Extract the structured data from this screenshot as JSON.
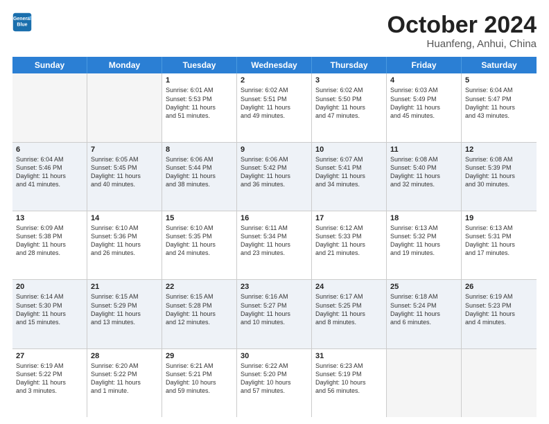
{
  "header": {
    "logo_line1": "General",
    "logo_line2": "Blue",
    "title": "October 2024",
    "subtitle": "Huanfeng, Anhui, China"
  },
  "weekdays": [
    "Sunday",
    "Monday",
    "Tuesday",
    "Wednesday",
    "Thursday",
    "Friday",
    "Saturday"
  ],
  "rows": [
    [
      {
        "day": "",
        "info": ""
      },
      {
        "day": "",
        "info": ""
      },
      {
        "day": "1",
        "info": "Sunrise: 6:01 AM\nSunset: 5:53 PM\nDaylight: 11 hours\nand 51 minutes."
      },
      {
        "day": "2",
        "info": "Sunrise: 6:02 AM\nSunset: 5:51 PM\nDaylight: 11 hours\nand 49 minutes."
      },
      {
        "day": "3",
        "info": "Sunrise: 6:02 AM\nSunset: 5:50 PM\nDaylight: 11 hours\nand 47 minutes."
      },
      {
        "day": "4",
        "info": "Sunrise: 6:03 AM\nSunset: 5:49 PM\nDaylight: 11 hours\nand 45 minutes."
      },
      {
        "day": "5",
        "info": "Sunrise: 6:04 AM\nSunset: 5:47 PM\nDaylight: 11 hours\nand 43 minutes."
      }
    ],
    [
      {
        "day": "6",
        "info": "Sunrise: 6:04 AM\nSunset: 5:46 PM\nDaylight: 11 hours\nand 41 minutes."
      },
      {
        "day": "7",
        "info": "Sunrise: 6:05 AM\nSunset: 5:45 PM\nDaylight: 11 hours\nand 40 minutes."
      },
      {
        "day": "8",
        "info": "Sunrise: 6:06 AM\nSunset: 5:44 PM\nDaylight: 11 hours\nand 38 minutes."
      },
      {
        "day": "9",
        "info": "Sunrise: 6:06 AM\nSunset: 5:42 PM\nDaylight: 11 hours\nand 36 minutes."
      },
      {
        "day": "10",
        "info": "Sunrise: 6:07 AM\nSunset: 5:41 PM\nDaylight: 11 hours\nand 34 minutes."
      },
      {
        "day": "11",
        "info": "Sunrise: 6:08 AM\nSunset: 5:40 PM\nDaylight: 11 hours\nand 32 minutes."
      },
      {
        "day": "12",
        "info": "Sunrise: 6:08 AM\nSunset: 5:39 PM\nDaylight: 11 hours\nand 30 minutes."
      }
    ],
    [
      {
        "day": "13",
        "info": "Sunrise: 6:09 AM\nSunset: 5:38 PM\nDaylight: 11 hours\nand 28 minutes."
      },
      {
        "day": "14",
        "info": "Sunrise: 6:10 AM\nSunset: 5:36 PM\nDaylight: 11 hours\nand 26 minutes."
      },
      {
        "day": "15",
        "info": "Sunrise: 6:10 AM\nSunset: 5:35 PM\nDaylight: 11 hours\nand 24 minutes."
      },
      {
        "day": "16",
        "info": "Sunrise: 6:11 AM\nSunset: 5:34 PM\nDaylight: 11 hours\nand 23 minutes."
      },
      {
        "day": "17",
        "info": "Sunrise: 6:12 AM\nSunset: 5:33 PM\nDaylight: 11 hours\nand 21 minutes."
      },
      {
        "day": "18",
        "info": "Sunrise: 6:13 AM\nSunset: 5:32 PM\nDaylight: 11 hours\nand 19 minutes."
      },
      {
        "day": "19",
        "info": "Sunrise: 6:13 AM\nSunset: 5:31 PM\nDaylight: 11 hours\nand 17 minutes."
      }
    ],
    [
      {
        "day": "20",
        "info": "Sunrise: 6:14 AM\nSunset: 5:30 PM\nDaylight: 11 hours\nand 15 minutes."
      },
      {
        "day": "21",
        "info": "Sunrise: 6:15 AM\nSunset: 5:29 PM\nDaylight: 11 hours\nand 13 minutes."
      },
      {
        "day": "22",
        "info": "Sunrise: 6:15 AM\nSunset: 5:28 PM\nDaylight: 11 hours\nand 12 minutes."
      },
      {
        "day": "23",
        "info": "Sunrise: 6:16 AM\nSunset: 5:27 PM\nDaylight: 11 hours\nand 10 minutes."
      },
      {
        "day": "24",
        "info": "Sunrise: 6:17 AM\nSunset: 5:25 PM\nDaylight: 11 hours\nand 8 minutes."
      },
      {
        "day": "25",
        "info": "Sunrise: 6:18 AM\nSunset: 5:24 PM\nDaylight: 11 hours\nand 6 minutes."
      },
      {
        "day": "26",
        "info": "Sunrise: 6:19 AM\nSunset: 5:23 PM\nDaylight: 11 hours\nand 4 minutes."
      }
    ],
    [
      {
        "day": "27",
        "info": "Sunrise: 6:19 AM\nSunset: 5:22 PM\nDaylight: 11 hours\nand 3 minutes."
      },
      {
        "day": "28",
        "info": "Sunrise: 6:20 AM\nSunset: 5:22 PM\nDaylight: 11 hours\nand 1 minute."
      },
      {
        "day": "29",
        "info": "Sunrise: 6:21 AM\nSunset: 5:21 PM\nDaylight: 10 hours\nand 59 minutes."
      },
      {
        "day": "30",
        "info": "Sunrise: 6:22 AM\nSunset: 5:20 PM\nDaylight: 10 hours\nand 57 minutes."
      },
      {
        "day": "31",
        "info": "Sunrise: 6:23 AM\nSunset: 5:19 PM\nDaylight: 10 hours\nand 56 minutes."
      },
      {
        "day": "",
        "info": ""
      },
      {
        "day": "",
        "info": ""
      }
    ]
  ]
}
